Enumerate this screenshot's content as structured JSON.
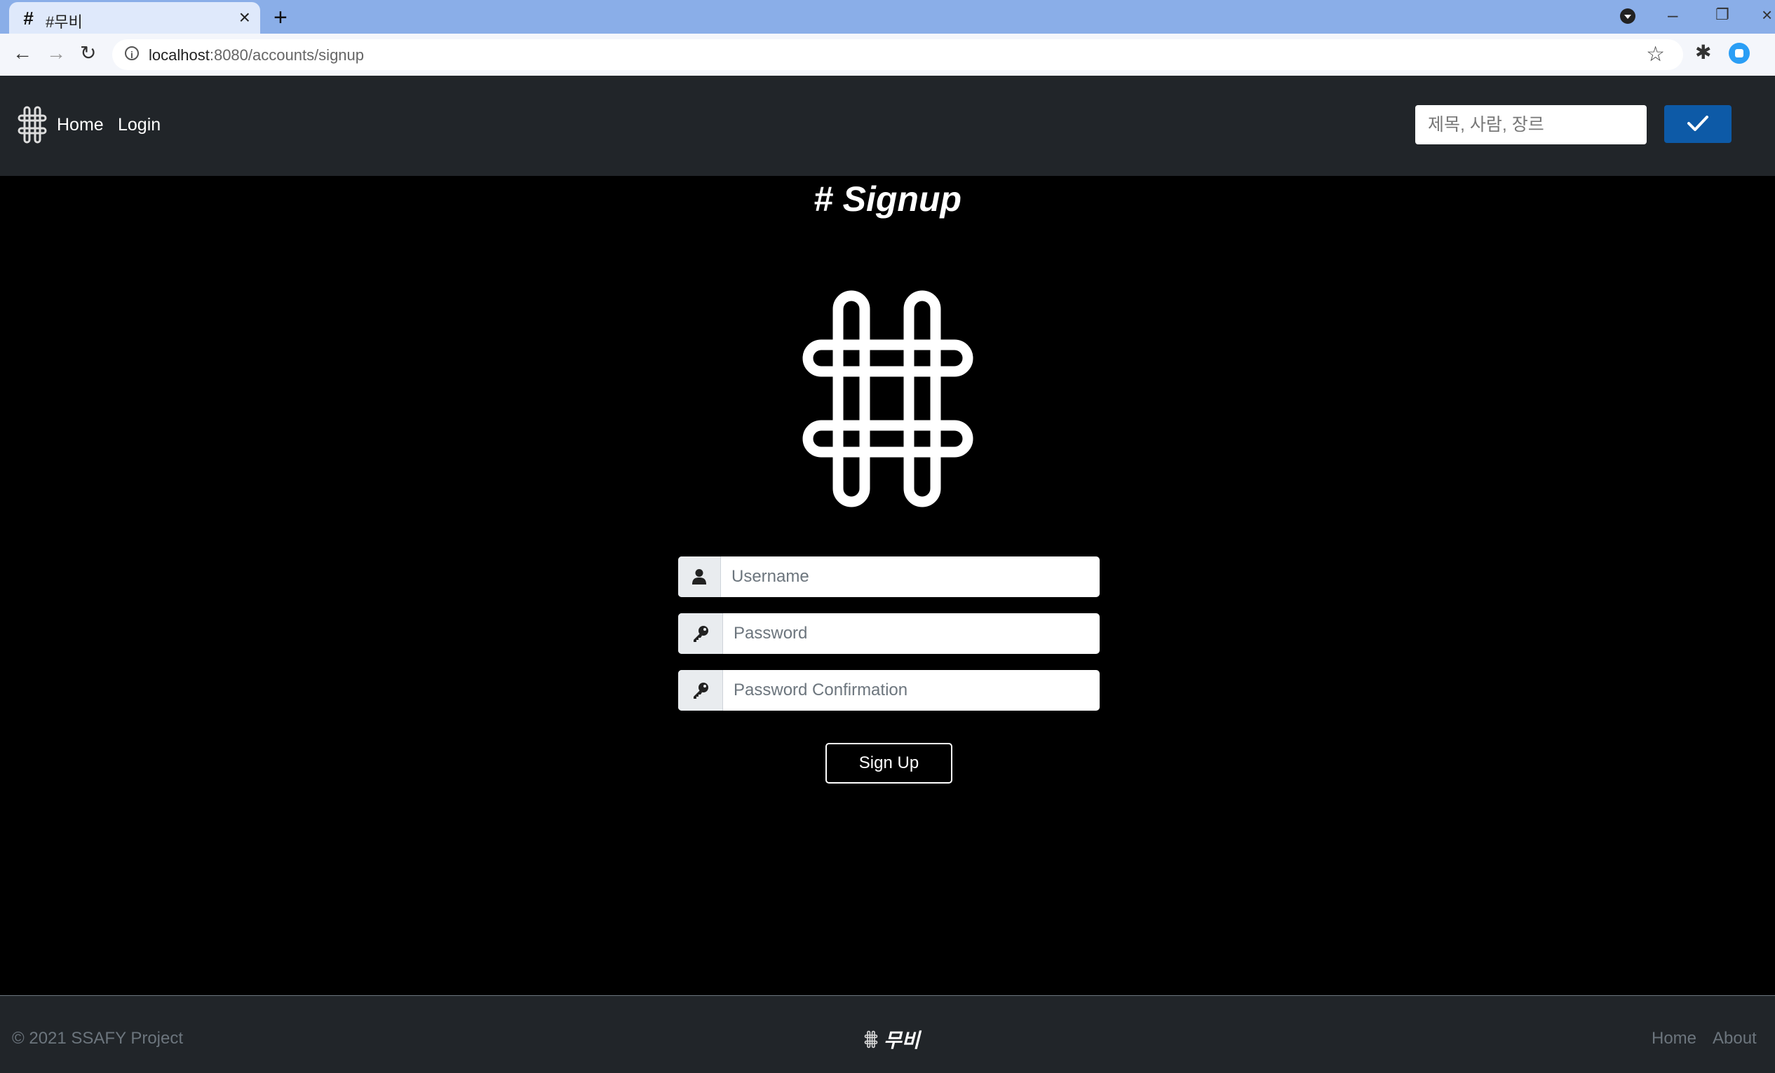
{
  "browser": {
    "tab_title": "#무비",
    "tab_favicon": "#",
    "url_host": "localhost",
    "url_rest": ":8080/accounts/signup"
  },
  "navbar": {
    "links": [
      "Home",
      "Login"
    ],
    "search_placeholder": "제목, 사람, 장르",
    "accent_color": "#0d5aa7"
  },
  "main": {
    "title": "# Signup",
    "username_placeholder": "Username",
    "password_placeholder": "Password",
    "password_confirm_placeholder": "Password Confirmation",
    "signup_label": "Sign Up"
  },
  "footer": {
    "copyright": "© 2021 SSAFY Project",
    "brand": "무비",
    "links": [
      "Home",
      "About"
    ]
  },
  "icons": {
    "navbar_logo": "hash-logo-icon",
    "search_button": "check-icon",
    "username_addon": "user-icon",
    "password_addon": "key-icon"
  }
}
